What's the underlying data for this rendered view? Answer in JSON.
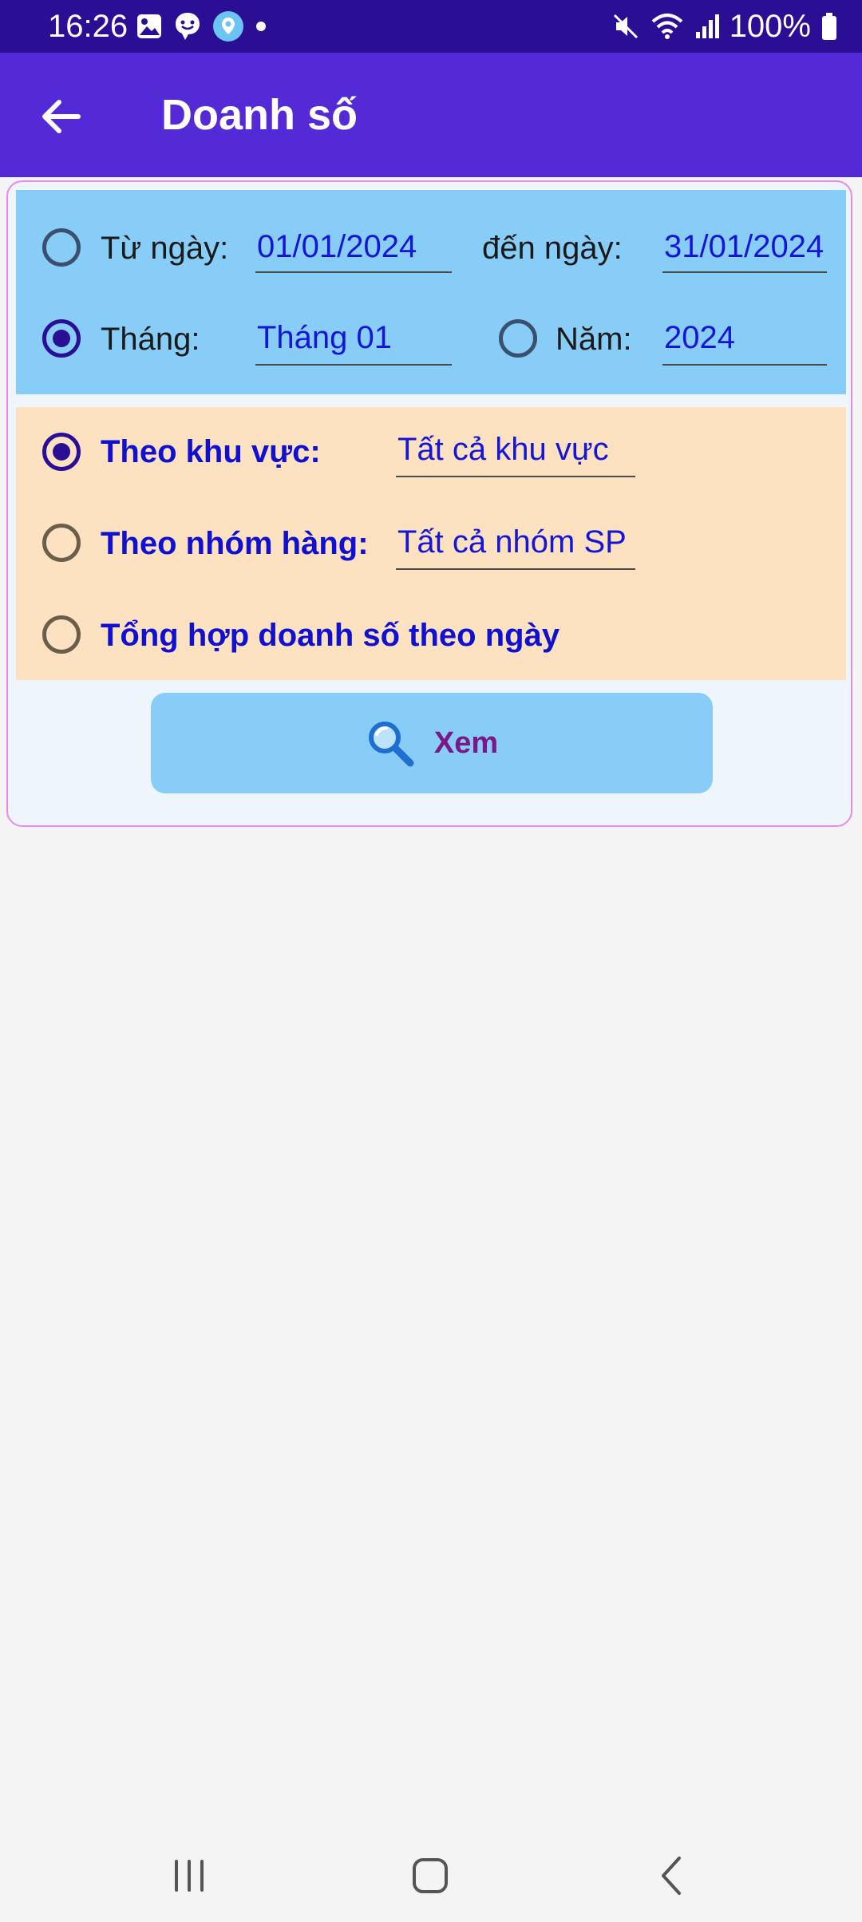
{
  "status_bar": {
    "time": "16:26",
    "battery": "100%",
    "icons_left": [
      "gallery-icon",
      "messenger-icon",
      "location-app-icon",
      "dot-icon"
    ],
    "icons_right": [
      "mute-icon",
      "wifi-icon",
      "signal-icon",
      "battery-icon"
    ]
  },
  "app_bar": {
    "title": "Doanh số",
    "back_icon": "arrow-left-icon",
    "background": "#532ad6"
  },
  "date_section": {
    "from_label": "Từ ngày:",
    "from_value": "01/01/2024",
    "to_label": "đến ngày:",
    "to_value": "31/01/2024",
    "month_label": "Tháng:",
    "month_value": "Tháng 01",
    "year_label": "Năm:",
    "year_value": "2024",
    "selected": "month",
    "background": "#87cdf8"
  },
  "filter_section": {
    "region_label": "Theo khu vực:",
    "region_value": "Tất cả khu vực",
    "group_label": "Theo nhóm hàng:",
    "group_value": "Tất cả nhóm SP",
    "daily_label": "Tổng hợp doanh số theo ngày",
    "selected": "region",
    "background": "#fde2c2"
  },
  "view_button": {
    "label": "Xem",
    "icon": "search-icon"
  },
  "nav_bar": {
    "items": [
      "recent-apps-icon",
      "home-icon",
      "back-icon"
    ]
  }
}
